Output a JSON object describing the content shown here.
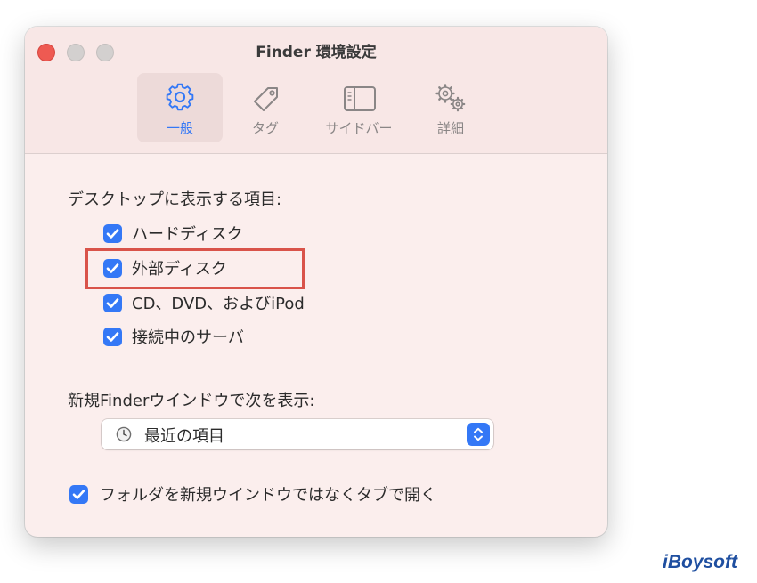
{
  "window": {
    "title": "Finder 環境設定"
  },
  "tabs": [
    {
      "label": "一般",
      "icon": "gear-icon",
      "selected": true
    },
    {
      "label": "タグ",
      "icon": "tag-icon",
      "selected": false
    },
    {
      "label": "サイドバー",
      "icon": "sidebar-icon",
      "selected": false
    },
    {
      "label": "詳細",
      "icon": "gears-icon",
      "selected": false
    }
  ],
  "desktop": {
    "heading": "デスクトップに表示する項目:",
    "items": [
      {
        "label": "ハードディスク",
        "checked": true
      },
      {
        "label": "外部ディスク",
        "checked": true
      },
      {
        "label": "CD、DVD、およびiPod",
        "checked": true
      },
      {
        "label": "接続中のサーバ",
        "checked": true
      }
    ]
  },
  "new_window": {
    "heading": "新規Finderウインドウで次を表示:",
    "selected_value": "最近の項目"
  },
  "folders_in_tabs": {
    "label": "フォルダを新規ウインドウではなくタブで開く",
    "checked": true
  },
  "brand": {
    "text": "iBoysoft"
  },
  "colors": {
    "accent": "#3478f6",
    "highlight": "#d9534a",
    "close": "#ee5a52"
  }
}
